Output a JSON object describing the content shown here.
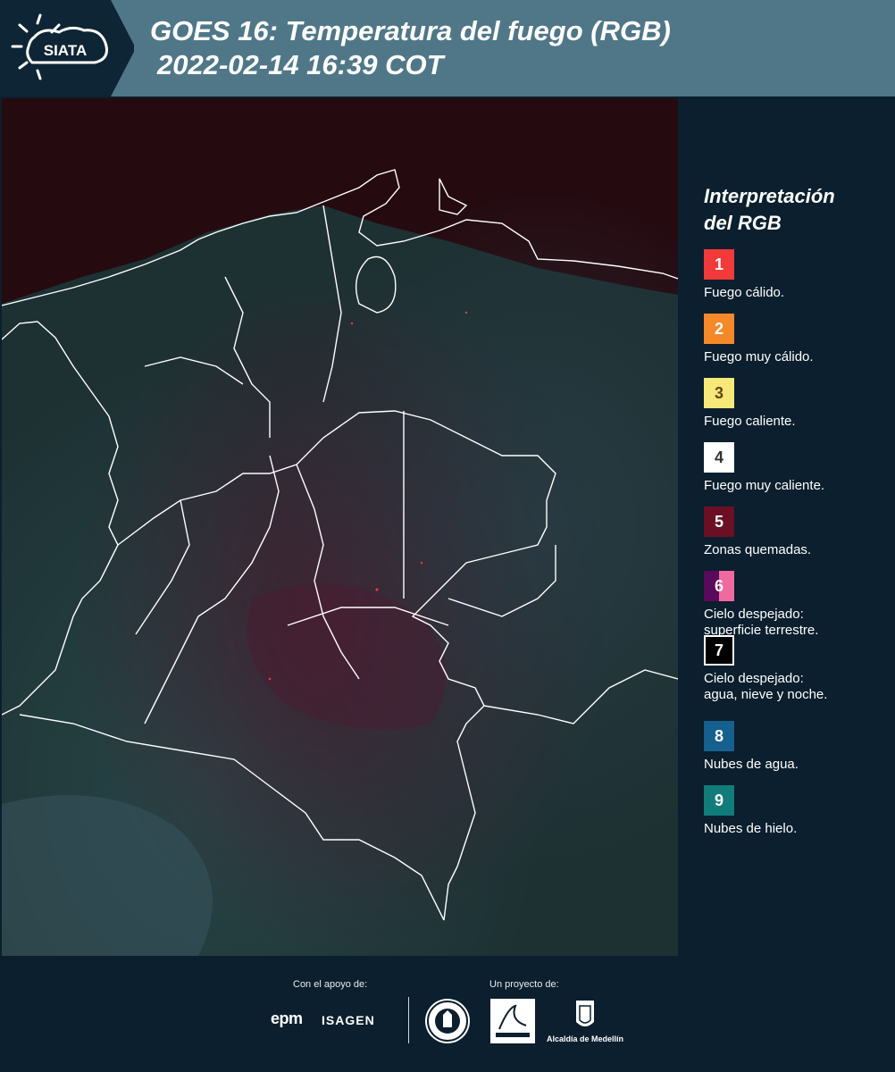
{
  "header": {
    "logo_text": "SIATA",
    "title_line1": "GOES 16: Temperatura del fuego (RGB)",
    "title_line2": "2022-02-14 16:39 COT"
  },
  "legend": {
    "title_line1": "Interpretación",
    "title_line2": "del RGB",
    "items": [
      {
        "number": "1",
        "label": "Fuego cálido.",
        "color": "#f23a3a"
      },
      {
        "number": "2",
        "label": "Fuego muy cálido.",
        "color": "#f5892a"
      },
      {
        "number": "3",
        "label": "Fuego caliente.",
        "color": "#f7e87a"
      },
      {
        "number": "4",
        "label": "Fuego muy caliente.",
        "color": "#ffffff"
      },
      {
        "number": "5",
        "label": "Zonas quemadas.",
        "color": "#6b1024"
      },
      {
        "number": "6",
        "label": "Cielo despejado: superficie terrestre.",
        "label_line1": "Cielo despejado:",
        "label_line2": "superficie terrestre.",
        "color": "#5a0a5a",
        "color2": "#f06aa0"
      },
      {
        "number": "7",
        "label": "Cielo despejado: agua, nieve y noche.",
        "label_line1": "Cielo despejado:",
        "label_line2": "agua, nieve y noche.",
        "color": "#000000"
      },
      {
        "number": "8",
        "label": "Nubes de agua.",
        "color": "#15608f"
      },
      {
        "number": "9",
        "label": "Nubes de hielo.",
        "color": "#117c7a"
      }
    ]
  },
  "footer": {
    "support_label": "Con el apoyo de:",
    "project_label": "Un proyecto de:",
    "sponsor1": "epm",
    "sponsor2": "ISAGEN",
    "partner_medellin": "Alcaldía de Medellín"
  },
  "colors": {
    "header_bg": "#4f7787",
    "page_bg": "#0b1f2e",
    "map_land": "#1d3133",
    "map_sea": "#250a10"
  }
}
